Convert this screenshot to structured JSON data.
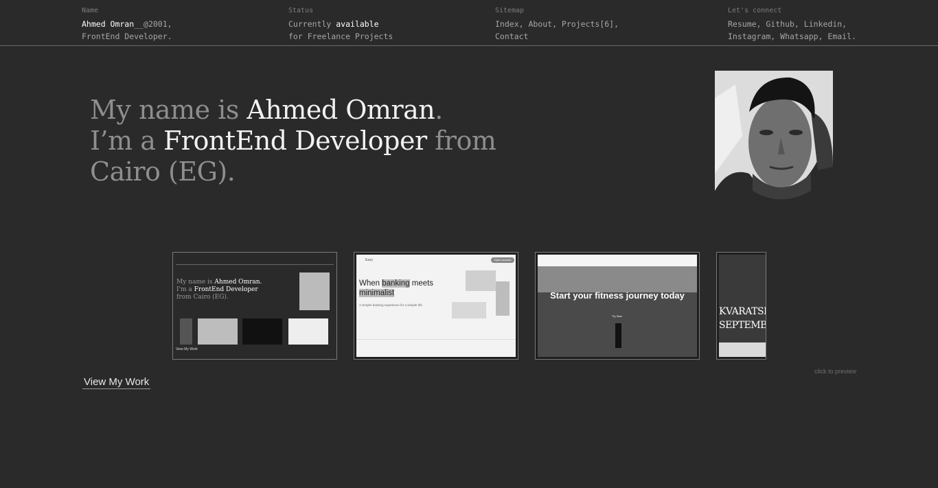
{
  "header": {
    "name": {
      "label": "Name",
      "line1_name": "Ahmed Omran",
      "line1_rest": "__@2001,",
      "line2": "FrontEnd Developer."
    },
    "status": {
      "label": "Status",
      "line1_pre": "Currently ",
      "line1_strong": "available",
      "line2": "for Freelance Projects"
    },
    "sitemap": {
      "label": "Sitemap",
      "line1": "Index, About, Projects[6],",
      "line2": "Contact"
    },
    "connect": {
      "label": "Let's connect",
      "line1": "Resume, Github, Linkedin,",
      "line2": "Instagram, Whatsapp, Email."
    }
  },
  "hero": {
    "p1": "My name is ",
    "name": "Ahmed Omran",
    "p2": ".",
    "p3": "I’m a ",
    "role": "FrontEnd Developer",
    "p4": " from",
    "p5": "Cairo (EG)."
  },
  "projects": {
    "thumb1": {
      "hero_l1_pre": "My name is ",
      "hero_l1_name": "Ahmed Omran.",
      "hero_l2_pre": "I'm a ",
      "hero_l2_role": "FrontEnd Developer",
      "hero_l3": "from Cairo (EG).",
      "footer": "View My Work"
    },
    "thumb2": {
      "brand": "Eazy",
      "headline_pre": "When ",
      "headline_mark": "banking",
      "headline_post": " meets",
      "headline_l2": "minimalist",
      "sub": "A simpler banking experience for a simpler life.",
      "cta": "Open account"
    },
    "thumb3": {
      "headline": "Start your fitness journey today",
      "cta": "Try Now"
    },
    "thumb4": {
      "l1": "KVARATSK",
      "l2": "SEPTEMBE"
    }
  },
  "cta": {
    "view_work": "View My Work",
    "preview_hint": "click to preview"
  },
  "colors": {
    "background": "#2b2a2a",
    "text_dim": "#8e8e8e",
    "text_bright": "#f2f2f2"
  }
}
